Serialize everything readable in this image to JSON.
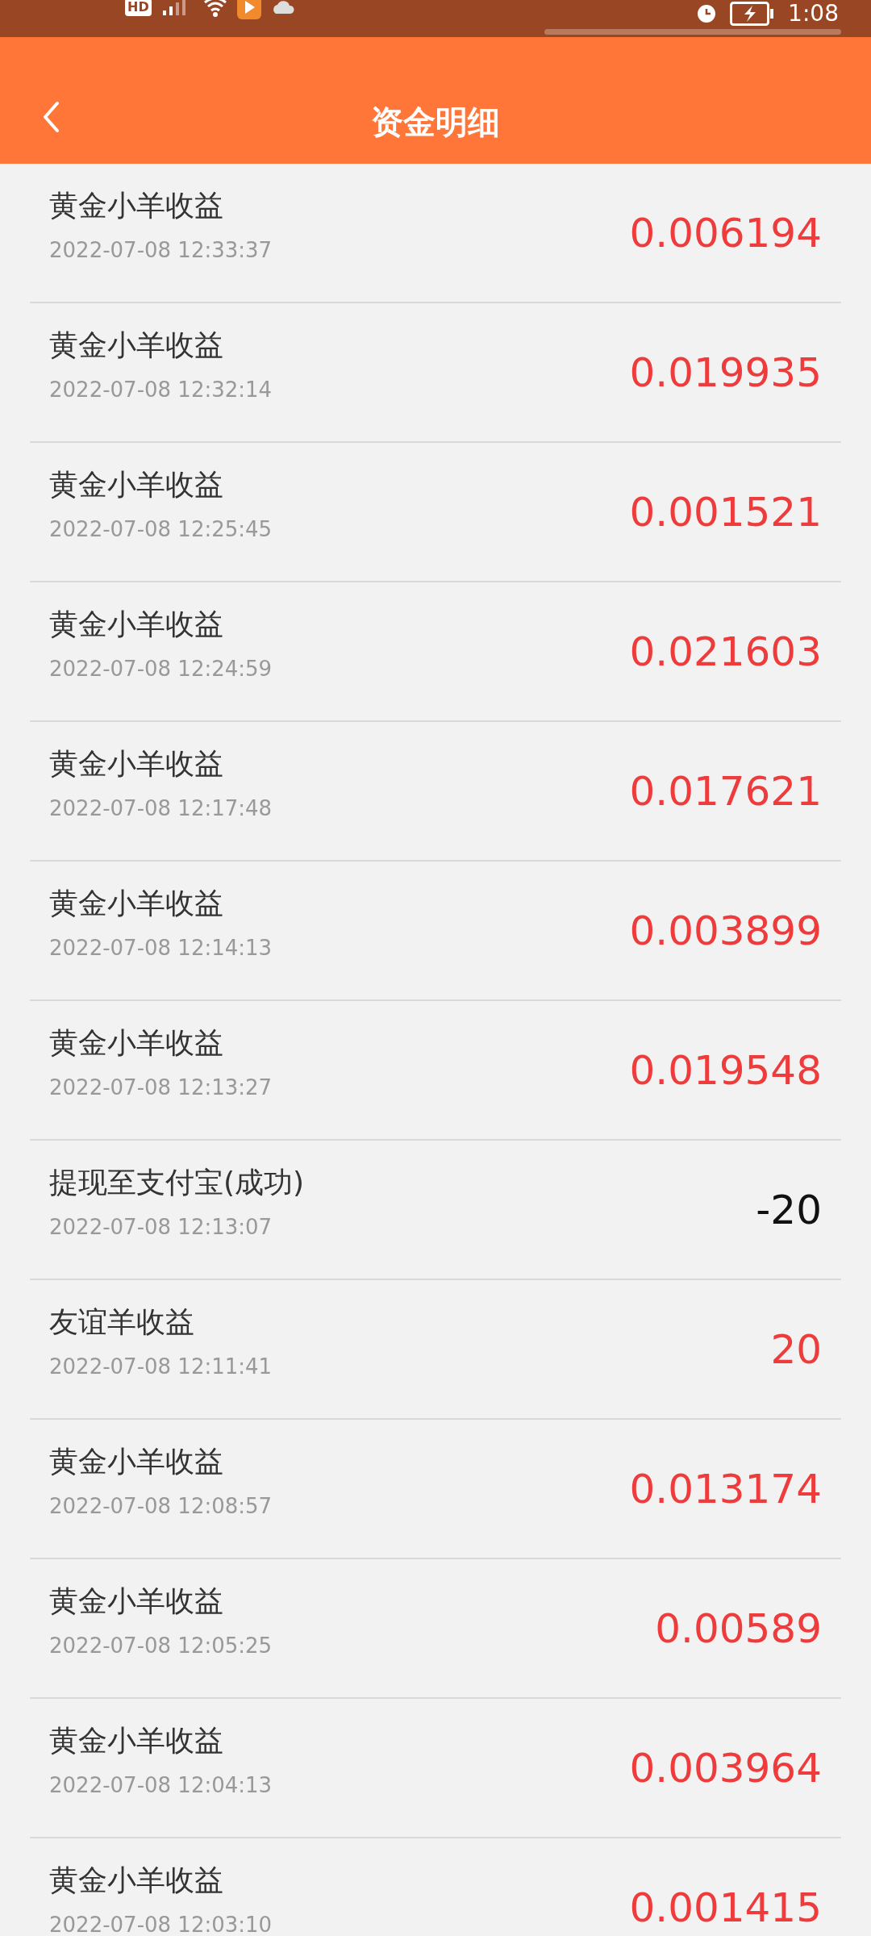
{
  "status_bar": {
    "network_badge": "HD",
    "time": "1:08"
  },
  "header": {
    "title": "资金明细"
  },
  "records": [
    {
      "title": "黄金小羊收益",
      "time": "2022-07-08 12:33:37",
      "amount": "0.006194",
      "kind": "income"
    },
    {
      "title": "黄金小羊收益",
      "time": "2022-07-08 12:32:14",
      "amount": "0.019935",
      "kind": "income"
    },
    {
      "title": "黄金小羊收益",
      "time": "2022-07-08 12:25:45",
      "amount": "0.001521",
      "kind": "income"
    },
    {
      "title": "黄金小羊收益",
      "time": "2022-07-08 12:24:59",
      "amount": "0.021603",
      "kind": "income"
    },
    {
      "title": "黄金小羊收益",
      "time": "2022-07-08 12:17:48",
      "amount": "0.017621",
      "kind": "income"
    },
    {
      "title": "黄金小羊收益",
      "time": "2022-07-08 12:14:13",
      "amount": "0.003899",
      "kind": "income"
    },
    {
      "title": "黄金小羊收益",
      "time": "2022-07-08 12:13:27",
      "amount": "0.019548",
      "kind": "income"
    },
    {
      "title": "提现至支付宝(成功)",
      "time": "2022-07-08 12:13:07",
      "amount": "-20",
      "kind": "withdrawal"
    },
    {
      "title": "友谊羊收益",
      "time": "2022-07-08 12:11:41",
      "amount": "20",
      "kind": "income"
    },
    {
      "title": "黄金小羊收益",
      "time": "2022-07-08 12:08:57",
      "amount": "0.013174",
      "kind": "income"
    },
    {
      "title": "黄金小羊收益",
      "time": "2022-07-08 12:05:25",
      "amount": "0.00589",
      "kind": "income"
    },
    {
      "title": "黄金小羊收益",
      "time": "2022-07-08 12:04:13",
      "amount": "0.003964",
      "kind": "income"
    },
    {
      "title": "黄金小羊收益",
      "time": "2022-07-08 12:03:10",
      "amount": "0.001415",
      "kind": "income"
    }
  ]
}
